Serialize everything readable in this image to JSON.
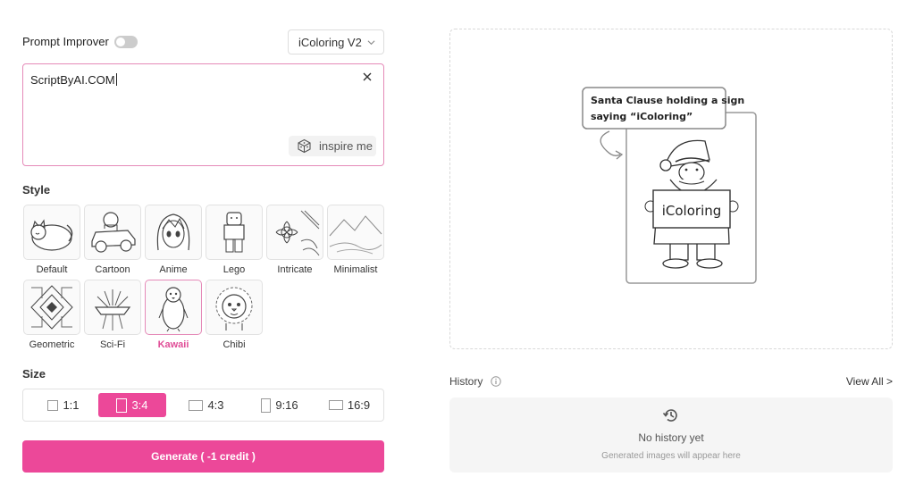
{
  "prompt_improver": {
    "label": "Prompt Improver",
    "enabled": false
  },
  "model": {
    "selected": "iColoring V2"
  },
  "prompt": {
    "value": "ScriptByAI.COM",
    "inspire_label": "inspire me"
  },
  "style": {
    "title": "Style",
    "selected": "Kawaii",
    "items": [
      {
        "label": "Default",
        "icon": "sleeping-cat-icon"
      },
      {
        "label": "Cartoon",
        "icon": "cartoon-car-icon"
      },
      {
        "label": "Anime",
        "icon": "anime-girl-icon"
      },
      {
        "label": "Lego",
        "icon": "lego-figure-icon"
      },
      {
        "label": "Intricate",
        "icon": "intricate-flower-icon"
      },
      {
        "label": "Minimalist",
        "icon": "minimalist-landscape-icon"
      },
      {
        "label": "Geometric",
        "icon": "geometric-pattern-icon"
      },
      {
        "label": "Sci-Fi",
        "icon": "scifi-ship-icon"
      },
      {
        "label": "Kawaii",
        "icon": "penguin-icon"
      },
      {
        "label": "Chibi",
        "icon": "lion-icon"
      }
    ]
  },
  "size": {
    "title": "Size",
    "selected": "3:4",
    "options": [
      "1:1",
      "3:4",
      "4:3",
      "9:16",
      "16:9"
    ]
  },
  "generate": {
    "label": "Generate ( -1 credit )"
  },
  "preview": {
    "callout_line1": "Santa Clause holding a sign",
    "callout_line2": "saying “iColoring”",
    "sign_text": "iColoring"
  },
  "history": {
    "label": "History",
    "view_all": "View All >",
    "empty_title": "No history yet",
    "empty_subtitle": "Generated images will appear here"
  },
  "colors": {
    "accent": "#ec4899",
    "accent_border": "#e58ab8"
  }
}
